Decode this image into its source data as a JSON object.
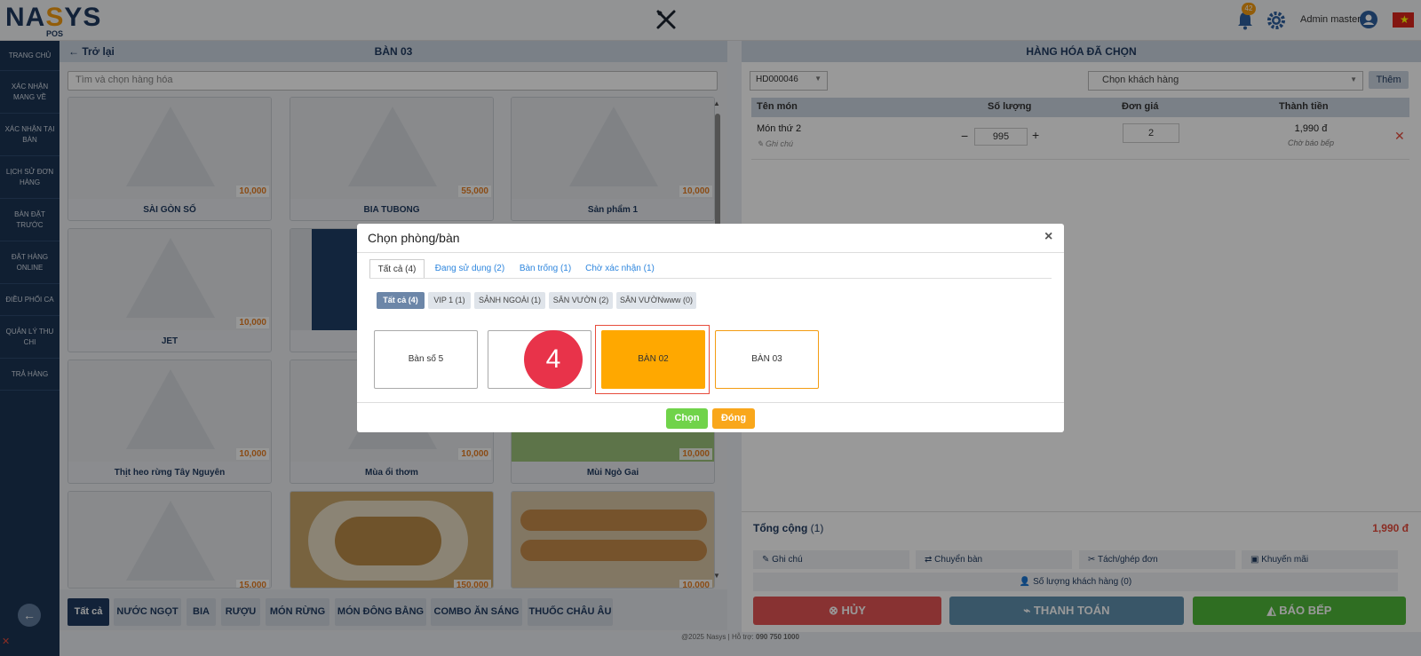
{
  "app": {
    "logo_text": "NASYS",
    "logo_sub": "POS",
    "notification_count": "42",
    "user_name": "Admin master"
  },
  "sidebar": {
    "items": [
      {
        "label": "TRANG CHỦ"
      },
      {
        "label": "XÁC NHẬN MANG VỀ"
      },
      {
        "label": "XÁC NHẬN TẠI BÀN"
      },
      {
        "label": "LỊCH SỬ ĐƠN HÀNG"
      },
      {
        "label": "BÀN ĐẶT TRƯỚC"
      },
      {
        "label": "ĐẶT HÀNG ONLINE"
      },
      {
        "label": "ĐIỀU PHỐI CA"
      },
      {
        "label": "QUẢN LÝ THU CHI"
      },
      {
        "label": "TRẢ HÀNG"
      }
    ]
  },
  "left": {
    "back_label": "Trở lại",
    "table_name": "BÀN 03",
    "search_placeholder": "Tìm và chọn hàng hóa",
    "products": [
      {
        "name": "SÀI GÒN SỐ",
        "price": "10,000"
      },
      {
        "name": "BIA TUBONG",
        "price": "55,000"
      },
      {
        "name": "Sản phẩm 1",
        "price": "10,000"
      },
      {
        "name": "JET",
        "price": "10,000"
      },
      {
        "name": "",
        "price": ""
      },
      {
        "name": "",
        "price": ""
      },
      {
        "name": "Thịt heo rừng Tây Nguyên",
        "price": "10,000"
      },
      {
        "name": "Mùa ổi thơm",
        "price": "10,000"
      },
      {
        "name": "Mùi Ngò Gai",
        "price": "10,000"
      },
      {
        "name": "",
        "price": "15,000"
      },
      {
        "name": "",
        "price": "150,000"
      },
      {
        "name": "",
        "price": "10,000"
      }
    ],
    "categories": [
      "Tất cả",
      "NƯỚC NGỌT",
      "BIA",
      "RƯỢU",
      "MÓN RỪNG",
      "MÓN ĐÔNG BẰNG",
      "COMBO ĂN SÁNG",
      "THUỐC CHÂU ÂU"
    ]
  },
  "right": {
    "title": "HÀNG HÓA ĐÃ CHỌN",
    "order_code": "HD000046",
    "customer_placeholder": "Chọn khách hàng",
    "add_label": "Thêm",
    "columns": {
      "name": "Tên món",
      "qty": "Số lượng",
      "price": "Đơn giá",
      "total": "Thành tiền"
    },
    "item": {
      "name": "Món thứ 2",
      "note": "Ghi chú",
      "qty": "995",
      "price": "2",
      "total": "1,990 đ",
      "status": "Chờ báo bếp"
    },
    "total_label": "Tổng cộng",
    "total_count": "(1)",
    "total_value": "1,990 đ",
    "actions": {
      "note": "Ghi chú",
      "move": "Chuyển bàn",
      "split": "Tách/ghép đơn",
      "promo": "Khuyến mãi",
      "guests": "Số lượng khách hàng (0)"
    },
    "buttons": {
      "cancel": "HỦY",
      "pay": "THANH TOÁN",
      "kitchen": "BÁO BẾP"
    },
    "colors": {
      "cancel": "#e35454",
      "pay": "#5f8fae",
      "kitchen": "#4fb83a"
    }
  },
  "footer": {
    "text": "@2025 Nasys | Hỗ trợ:",
    "phone": "090 750 1000"
  },
  "modal": {
    "title": "Chọn phòng/bàn",
    "tabs": [
      "Tất cả (4)",
      "Đang sử dụng (2)",
      "Bàn trống (1)",
      "Chờ xác nhận (1)"
    ],
    "areas": [
      "Tất cả (4)",
      "VIP 1 (1)",
      "SẢNH NGOÀI (1)",
      "SÂN VƯỜN (2)",
      "SÂN VƯỜNwww (0)"
    ],
    "tables": [
      "Bàn số 5",
      "",
      "BÀN 02",
      "BÀN 03"
    ],
    "step_number": "4",
    "choose_label": "Chọn",
    "close_label": "Đóng"
  }
}
